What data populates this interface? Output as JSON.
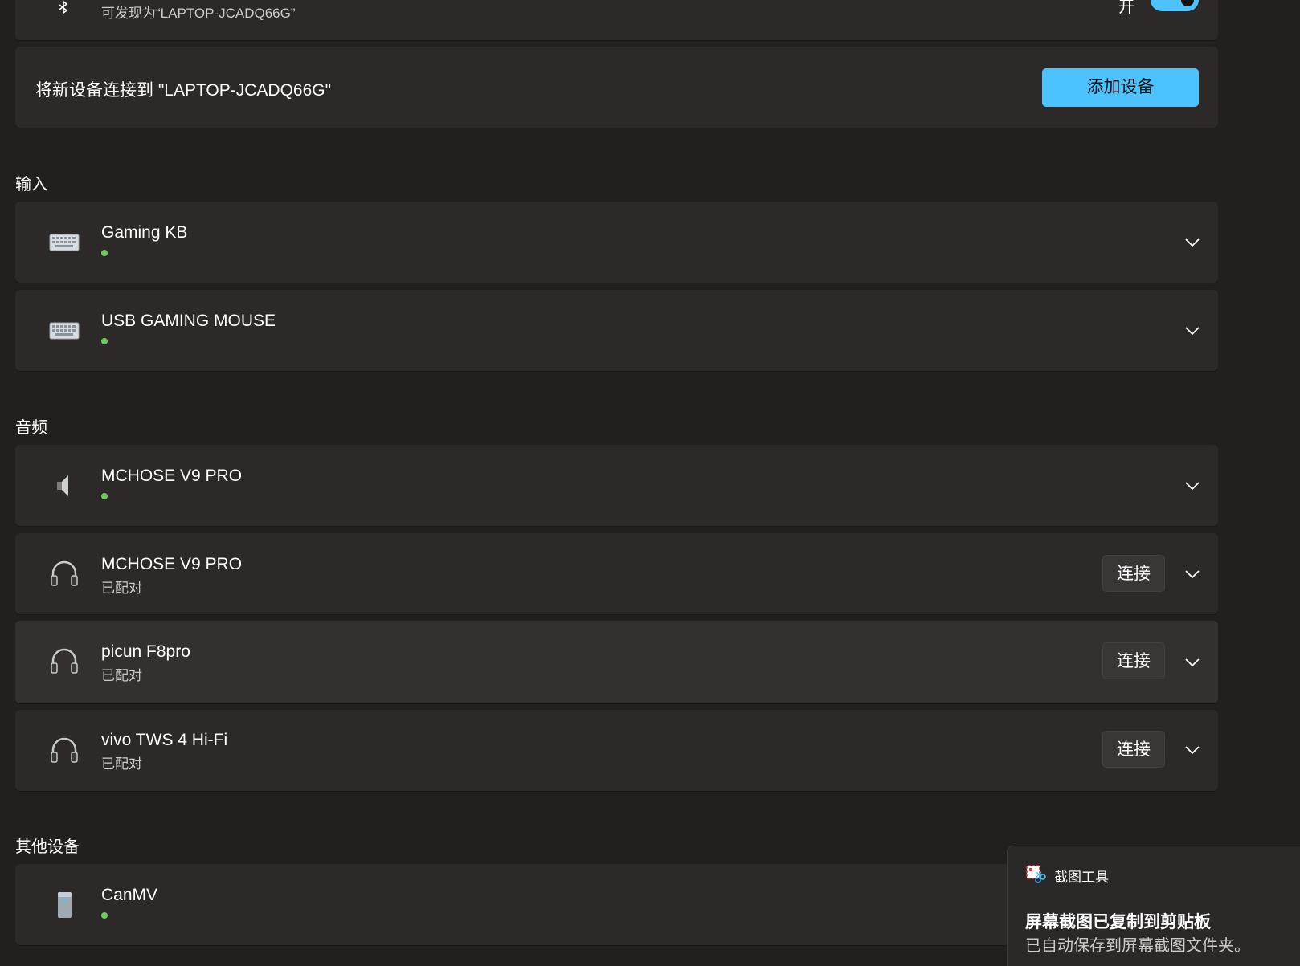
{
  "bluetooth": {
    "discoverable_text": "可发现为“LAPTOP-JCADQ66G”",
    "toggle_label": "开",
    "toggle_on": true
  },
  "add_device": {
    "text": "将新设备连接到 \"LAPTOP-JCADQ66G\"",
    "button": "添加设备"
  },
  "sections": {
    "input": "输入",
    "audio": "音频",
    "other": "其他设备"
  },
  "input_devices": [
    {
      "name": "Gaming KB",
      "icon": "keyboard-icon",
      "connected": true
    },
    {
      "name": "USB GAMING MOUSE",
      "icon": "keyboard-icon",
      "connected": true
    }
  ],
  "audio_devices": [
    {
      "name": "MCHOSE V9 PRO",
      "icon": "speaker-icon",
      "connected": true
    },
    {
      "name": "MCHOSE V9 PRO",
      "icon": "headphones-icon",
      "status": "已配对",
      "action": "连接"
    },
    {
      "name": "picun F8pro",
      "icon": "headphones-icon",
      "status": "已配对",
      "action": "连接"
    },
    {
      "name": "vivo TWS 4 Hi-Fi",
      "icon": "headphones-icon",
      "status": "已配对",
      "action": "连接"
    }
  ],
  "other_devices": [
    {
      "name": "CanMV",
      "icon": "pc-tower-icon",
      "connected": true
    }
  ],
  "toast": {
    "app_name": "截图工具",
    "title": "屏幕截图已复制到剪贴板",
    "body": "已自动保存到屏幕截图文件夹。"
  },
  "colors": {
    "accent": "#4cc2ff",
    "connected_dot": "#6ccb5f",
    "background": "#231f1f",
    "card": "#2d2929"
  }
}
